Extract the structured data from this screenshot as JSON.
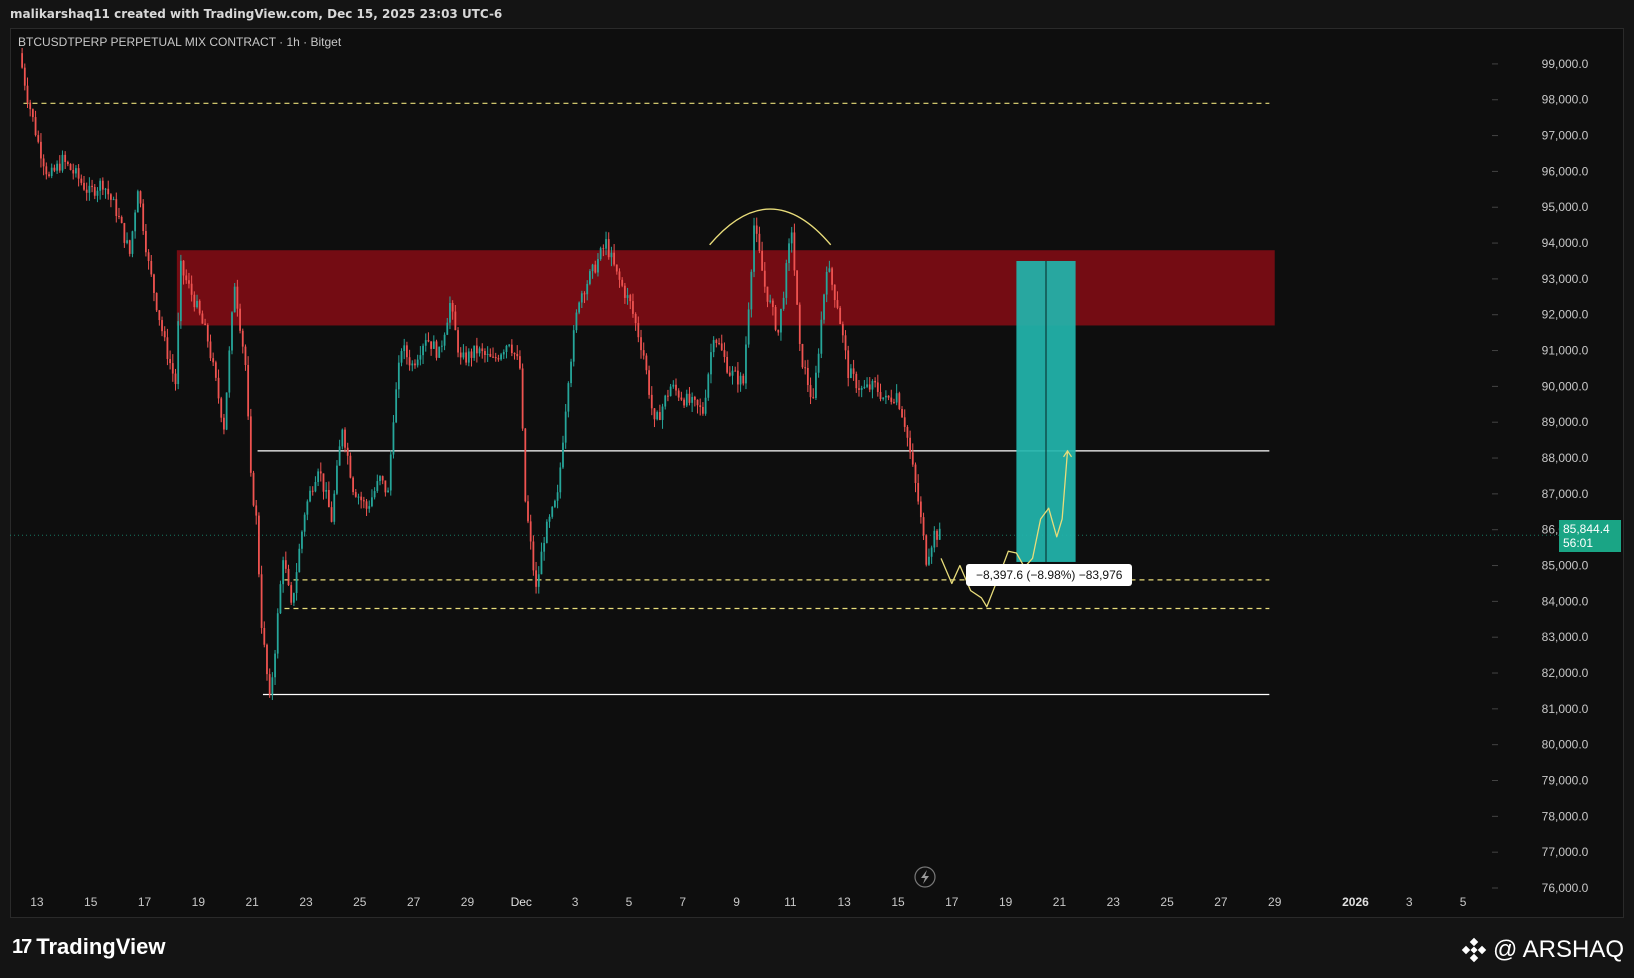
{
  "header": {
    "credit": "malikarshaq11 created with TradingView.com, Dec 15, 2025 23:03 UTC-6"
  },
  "symbol_line": "BTCUSDTPERP PERPETUAL MIX CONTRACT · 1h · Bitget",
  "colors": {
    "up": "#26a69a",
    "down": "#ef5350",
    "zone": "#7a0d14",
    "target": "#22b5ad",
    "dash": "#e8dc7a",
    "white": "#ffffff",
    "projection": "#e8dc7a"
  },
  "last_price": {
    "value": "85,844.4",
    "countdown": "56:01"
  },
  "measure_text": "−8,397.6 (−8.98%) −83,976",
  "footer": {
    "logo_text": "TradingView",
    "brand_text": "@ ARSHAQ"
  },
  "chart_data": {
    "type": "candlestick",
    "symbol": "BTCUSDTPERP PERPETUAL MIX CONTRACT",
    "interval": "1h",
    "exchange": "Bitget",
    "ylim": [
      76000,
      99500
    ],
    "y_ticks": [
      "99,000.0",
      "98,000.0",
      "97,000.0",
      "96,000.0",
      "95,000.0",
      "94,000.0",
      "93,000.0",
      "92,000.0",
      "91,000.0",
      "90,000.0",
      "89,000.0",
      "88,000.0",
      "87,000.0",
      "86,000.0",
      "85,000.0",
      "84,000.0",
      "83,000.0",
      "82,000.0",
      "81,000.0",
      "80,000.0",
      "79,000.0",
      "78,000.0",
      "77,000.0",
      "76,000.0"
    ],
    "x_ticks": [
      "13",
      "15",
      "17",
      "19",
      "21",
      "23",
      "25",
      "27",
      "29",
      "Dec",
      "3",
      "5",
      "7",
      "9",
      "11",
      "13",
      "15",
      "17",
      "19",
      "21",
      "23",
      "25",
      "27",
      "29",
      "2026",
      "3",
      "5"
    ],
    "x_tick_days": [
      -18,
      -16,
      -14,
      -12,
      -10,
      -8,
      -6,
      -4,
      -2,
      0,
      2,
      4,
      6,
      8,
      10,
      12,
      14,
      16,
      18,
      20,
      22,
      24,
      26,
      28,
      31,
      33,
      35
    ],
    "x_range_days": [
      -19,
      36
    ],
    "price_path": [
      [
        -18.6,
        99300
      ],
      [
        -18.3,
        98100
      ],
      [
        -17.9,
        96800
      ],
      [
        -17.5,
        95800
      ],
      [
        -17.0,
        96300
      ],
      [
        -16.5,
        95900
      ],
      [
        -16.0,
        95400
      ],
      [
        -15.5,
        95700
      ],
      [
        -15.0,
        94900
      ],
      [
        -14.5,
        93700
      ],
      [
        -14.2,
        95600
      ],
      [
        -13.8,
        93400
      ],
      [
        -13.2,
        91200
      ],
      [
        -12.8,
        90100
      ],
      [
        -12.6,
        93300
      ],
      [
        -12.1,
        92400
      ],
      [
        -11.6,
        91300
      ],
      [
        -11.0,
        88900
      ],
      [
        -10.6,
        92900
      ],
      [
        -10.2,
        90600
      ],
      [
        -10.0,
        87400
      ],
      [
        -9.8,
        86300
      ],
      [
        -9.6,
        83400
      ],
      [
        -9.3,
        81200
      ],
      [
        -9.1,
        82700
      ],
      [
        -8.8,
        85300
      ],
      [
        -8.5,
        83800
      ],
      [
        -8.0,
        86500
      ],
      [
        -7.5,
        87800
      ],
      [
        -7.0,
        86300
      ],
      [
        -6.6,
        88900
      ],
      [
        -6.2,
        87200
      ],
      [
        -5.7,
        86600
      ],
      [
        -5.2,
        87400
      ],
      [
        -4.9,
        87000
      ],
      [
        -4.7,
        89200
      ],
      [
        -4.4,
        91100
      ],
      [
        -4.0,
        90600
      ],
      [
        -3.5,
        91400
      ],
      [
        -3.0,
        90900
      ],
      [
        -2.6,
        92300
      ],
      [
        -2.2,
        90700
      ],
      [
        -1.6,
        91000
      ],
      [
        -1.0,
        90700
      ],
      [
        -0.4,
        91300
      ],
      [
        0.0,
        90500
      ],
      [
        0.2,
        86800
      ],
      [
        0.6,
        84300
      ],
      [
        0.9,
        85800
      ],
      [
        1.4,
        86900
      ],
      [
        1.8,
        90300
      ],
      [
        2.2,
        92500
      ],
      [
        2.7,
        93200
      ],
      [
        3.2,
        94000
      ],
      [
        3.6,
        93100
      ],
      [
        4.1,
        92300
      ],
      [
        4.6,
        90900
      ],
      [
        5.0,
        88900
      ],
      [
        5.6,
        90000
      ],
      [
        6.2,
        89600
      ],
      [
        6.8,
        89300
      ],
      [
        7.2,
        91500
      ],
      [
        7.8,
        90400
      ],
      [
        8.3,
        90100
      ],
      [
        8.7,
        94500
      ],
      [
        9.1,
        92800
      ],
      [
        9.6,
        91500
      ],
      [
        10.1,
        94400
      ],
      [
        10.4,
        91000
      ],
      [
        10.9,
        89500
      ],
      [
        11.4,
        93400
      ],
      [
        11.8,
        92300
      ],
      [
        12.2,
        90400
      ],
      [
        12.7,
        89900
      ],
      [
        13.2,
        90000
      ],
      [
        13.6,
        89600
      ],
      [
        14.0,
        89800
      ],
      [
        14.3,
        89000
      ],
      [
        14.8,
        86800
      ],
      [
        15.1,
        85200
      ],
      [
        15.4,
        85900
      ],
      [
        15.6,
        85844
      ]
    ],
    "resistance_zone": {
      "low": 91700,
      "high": 93800,
      "from_day": -12.8,
      "to_day": 28
    },
    "levels": [
      {
        "price": 97900,
        "style": "dashed",
        "color": "yellow",
        "from_day": -18.5,
        "to_day": 27.8
      },
      {
        "price": 88200,
        "style": "solid",
        "color": "white",
        "from_day": -9.8,
        "to_day": 27.8
      },
      {
        "price": 84600,
        "style": "dashed",
        "color": "yellow",
        "from_day": -8.8,
        "to_day": 27.8
      },
      {
        "price": 83800,
        "style": "dashed",
        "color": "yellow",
        "from_day": -8.8,
        "to_day": 27.8
      },
      {
        "price": 81400,
        "style": "solid",
        "color": "white",
        "from_day": -9.6,
        "to_day": 27.8
      }
    ],
    "arc": {
      "from_day": 7.0,
      "to_day": 11.5,
      "base": 93950,
      "peak": 94950
    },
    "target_box": {
      "from_day": 18.4,
      "to_day": 20.6,
      "low": 85100,
      "high": 93500
    },
    "projection_path": [
      [
        15.6,
        85200
      ],
      [
        16.0,
        84500
      ],
      [
        16.3,
        85000
      ],
      [
        16.7,
        84300
      ],
      [
        17.1,
        84100
      ],
      [
        17.3,
        83850
      ],
      [
        17.8,
        84800
      ],
      [
        18.1,
        85400
      ],
      [
        18.4,
        85350
      ],
      [
        18.7,
        84950
      ],
      [
        19.0,
        85200
      ],
      [
        19.3,
        86300
      ],
      [
        19.6,
        86600
      ],
      [
        19.9,
        85800
      ],
      [
        20.1,
        86300
      ],
      [
        20.3,
        88200
      ]
    ],
    "last_price": 85844.4
  }
}
